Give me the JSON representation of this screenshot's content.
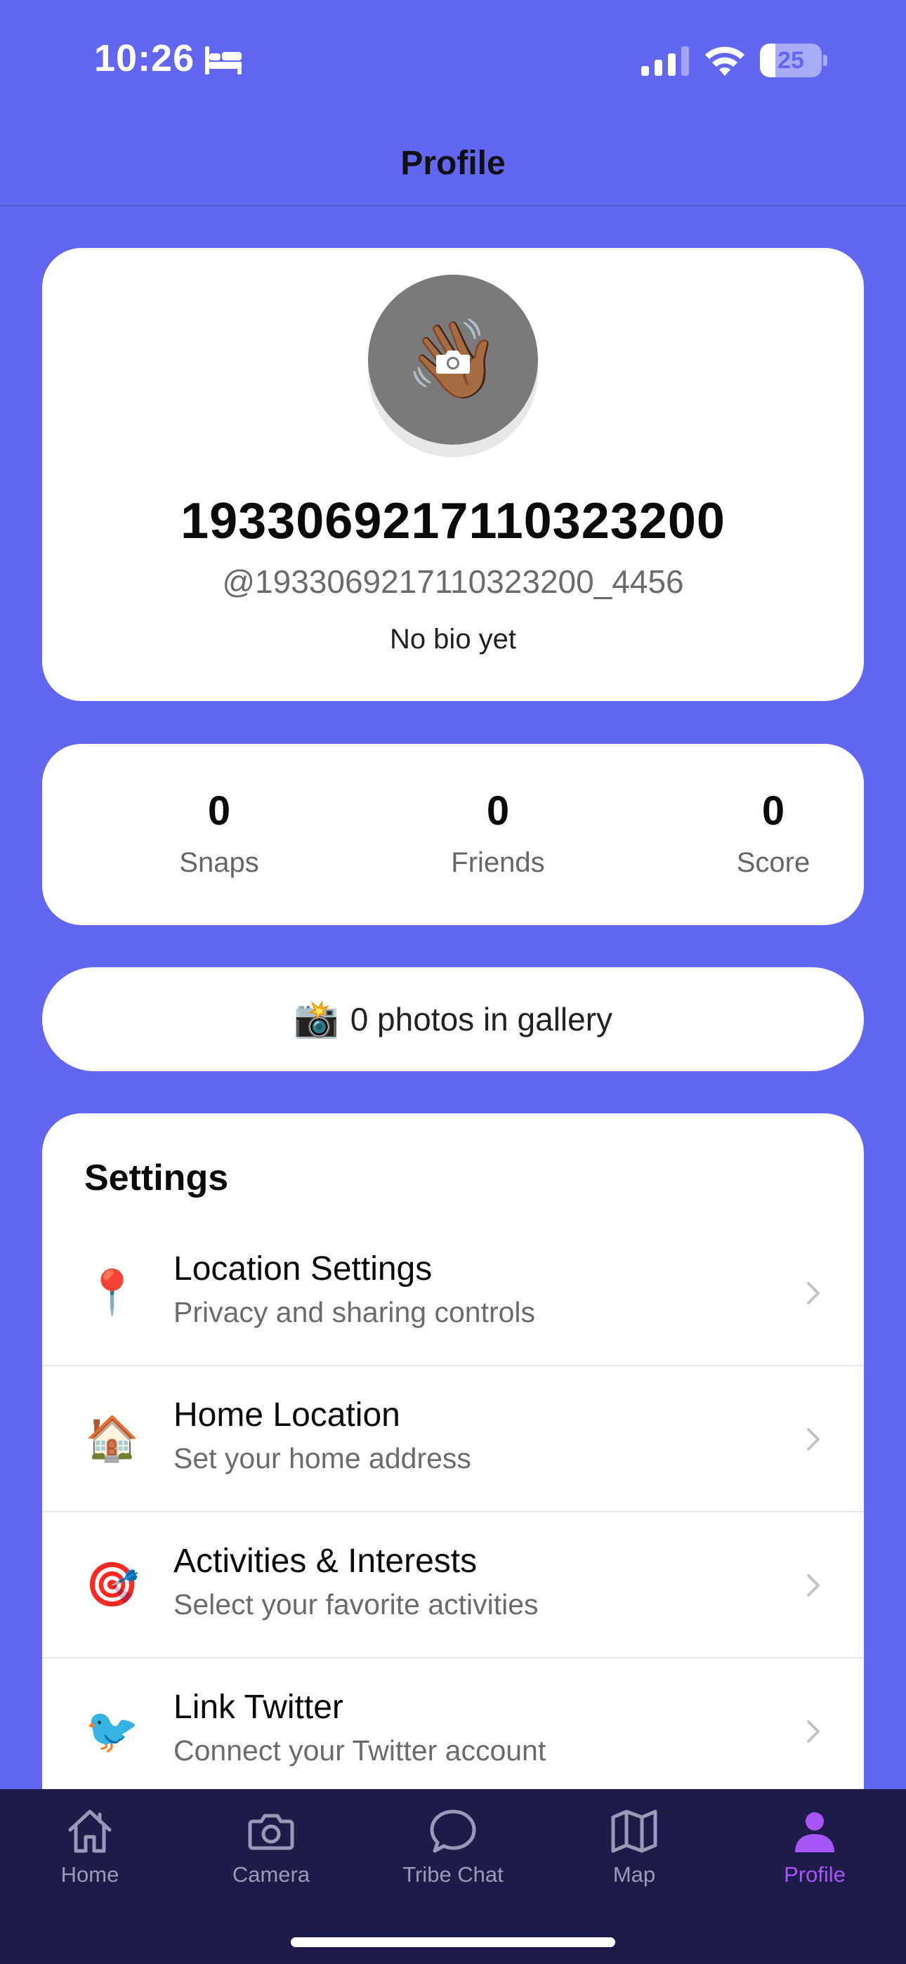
{
  "status_bar": {
    "time": "10:26",
    "battery": "25",
    "battery_level": 0.25,
    "icons": [
      "bed-icon",
      "signal-icon",
      "wifi-icon",
      "battery-icon"
    ]
  },
  "header": {
    "title": "Profile"
  },
  "profile": {
    "avatar_emoji": "👋🏾",
    "display_name": "1933069217110323200",
    "username": "@1933069217110323200_4456",
    "bio": "No bio yet"
  },
  "stats": [
    {
      "value": "0",
      "label": "Snaps"
    },
    {
      "value": "0",
      "label": "Friends"
    },
    {
      "value": "0",
      "label": "Score"
    }
  ],
  "gallery": {
    "emoji": "📸",
    "text": "0 photos in gallery"
  },
  "settings": {
    "title": "Settings",
    "items": [
      {
        "emoji": "📍",
        "title": "Location Settings",
        "subtitle": "Privacy and sharing controls"
      },
      {
        "emoji": "🏠",
        "title": "Home Location",
        "subtitle": "Set your home address"
      },
      {
        "emoji": "🎯",
        "title": "Activities & Interests",
        "subtitle": "Select your favorite activities"
      },
      {
        "emoji": "🐦",
        "title": "Link Twitter",
        "subtitle": "Connect your Twitter account"
      }
    ]
  },
  "tab_bar": {
    "tabs": [
      {
        "label": "Home",
        "icon": "home-icon"
      },
      {
        "label": "Camera",
        "icon": "camera-icon"
      },
      {
        "label": "Tribe Chat",
        "icon": "chat-bubble-icon"
      },
      {
        "label": "Map",
        "icon": "map-icon"
      },
      {
        "label": "Profile",
        "icon": "person-icon"
      }
    ],
    "active": "Profile"
  },
  "colors": {
    "background": "#6366F1",
    "tab_bar_background": "#1E1B4B",
    "active_tab": "#A855F7",
    "inactive_tab": "#9A9AB8"
  }
}
